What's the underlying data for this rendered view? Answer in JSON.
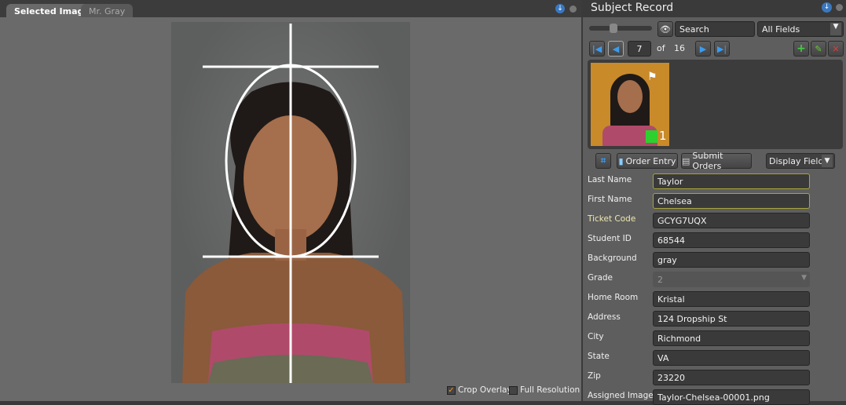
{
  "left": {
    "tabs": [
      {
        "label": "Selected Image"
      },
      {
        "label": "Mr. Gray"
      }
    ],
    "options": [
      {
        "label": "Crop Overlay",
        "checked": true
      },
      {
        "label": "Full Resolution",
        "checked": false
      }
    ]
  },
  "right": {
    "title": "Subject Record",
    "search": {
      "value": "Search",
      "scope": "All Fields"
    },
    "nav": {
      "current": "7",
      "of": "of",
      "total": "16"
    },
    "thumb": {
      "badge": "1",
      "flag_icon": "checkered-flag-icon"
    },
    "actions": {
      "order_entry": "Order Entry",
      "submit_orders": "Submit Orders",
      "display_fields": "Display Fields:"
    },
    "fields": [
      {
        "label": "Last Name",
        "value": "Taylor",
        "highlight": true
      },
      {
        "label": "First Name",
        "value": "Chelsea",
        "highlight": true
      },
      {
        "label": "Ticket Code",
        "value": "GCYG7UQX"
      },
      {
        "label": "Student ID",
        "value": "68544"
      },
      {
        "label": "Background",
        "value": "gray"
      },
      {
        "label": "Grade",
        "value": "2",
        "dropdown": true,
        "disabled": true
      },
      {
        "label": "Home Room",
        "value": "Kristal"
      },
      {
        "label": "Address",
        "value": "124 Dropship St"
      },
      {
        "label": "City",
        "value": "Richmond"
      },
      {
        "label": "State",
        "value": "VA"
      },
      {
        "label": "Zip",
        "value": "23220"
      },
      {
        "label": "Assigned Images",
        "value": "Taylor-Chelsea-00001.png"
      }
    ]
  },
  "colors": {
    "accent": "#e8962a",
    "highlight_border": "#a8a53a",
    "thumb_bg": "#c98a2a"
  }
}
